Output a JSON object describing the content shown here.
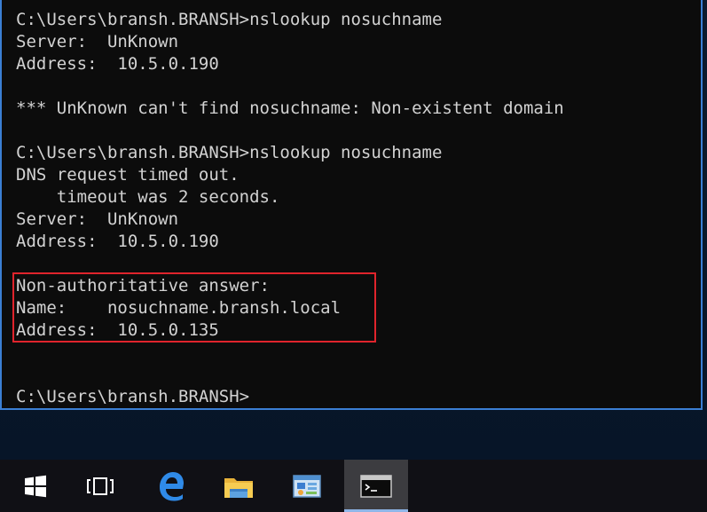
{
  "console": {
    "lines": [
      "C:\\Users\\bransh.BRANSH>nslookup nosuchname",
      "Server:  UnKnown",
      "Address:  10.5.0.190",
      "",
      "*** UnKnown can't find nosuchname: Non-existent domain",
      "",
      "C:\\Users\\bransh.BRANSH>nslookup nosuchname",
      "DNS request timed out.",
      "    timeout was 2 seconds.",
      "Server:  UnKnown",
      "Address:  10.5.0.190",
      "",
      "Non-authoritative answer:",
      "Name:    nosuchname.bransh.local",
      "Address:  10.5.0.135",
      "",
      "",
      "C:\\Users\\bransh.BRANSH>"
    ]
  },
  "colors": {
    "console_background": "#0c0c0c",
    "console_text": "#d2d2d2",
    "highlight_border": "#e0242c",
    "window_border": "#3b7fd4",
    "taskbar": "#101015"
  },
  "taskbar": {
    "items": [
      {
        "icon": "windows-start-icon"
      },
      {
        "icon": "task-view-icon"
      },
      {
        "icon": "edge-browser-icon"
      },
      {
        "icon": "file-explorer-icon"
      },
      {
        "icon": "control-panel-icon"
      },
      {
        "icon": "command-prompt-icon",
        "active": true
      }
    ]
  }
}
